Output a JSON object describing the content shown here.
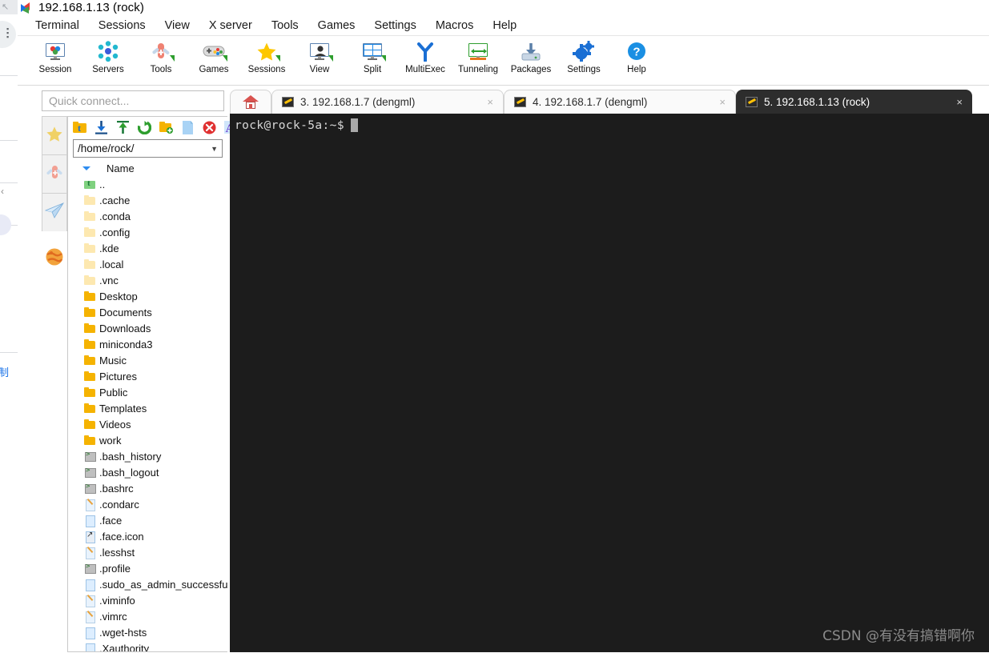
{
  "window": {
    "title": "192.168.1.13 (rock)",
    "logo_icon": "mobaxterm-logo-icon"
  },
  "menubar": {
    "items": [
      {
        "label": "Terminal"
      },
      {
        "label": "Sessions"
      },
      {
        "label": "View"
      },
      {
        "label": "X server"
      },
      {
        "label": "Tools"
      },
      {
        "label": "Games"
      },
      {
        "label": "Settings"
      },
      {
        "label": "Macros"
      },
      {
        "label": "Help"
      }
    ]
  },
  "toolbar": {
    "buttons": [
      {
        "label": "Session",
        "icon": "session-monitor-icon"
      },
      {
        "label": "Servers",
        "icon": "servers-nodes-icon"
      },
      {
        "label": "Tools",
        "icon": "swiss-knife-icon"
      },
      {
        "label": "Games",
        "icon": "gamepad-icon"
      },
      {
        "label": "Sessions",
        "icon": "star-icon"
      },
      {
        "label": "View",
        "icon": "view-monitor-icon"
      },
      {
        "label": "Split",
        "icon": "split-grid-icon"
      },
      {
        "label": "MultiExec",
        "icon": "multiexec-fork-icon"
      },
      {
        "label": "Tunneling",
        "icon": "tunneling-monitor-icon"
      },
      {
        "label": "Packages",
        "icon": "packages-download-icon"
      },
      {
        "label": "Settings",
        "icon": "gear-icon"
      },
      {
        "label": "Help",
        "icon": "help-question-icon"
      }
    ]
  },
  "sidebar": {
    "quick_connect": {
      "placeholder": "Quick connect..."
    },
    "vertical_tabs": [
      {
        "name": "sessions-star",
        "icon": "star-icon"
      },
      {
        "name": "tools",
        "icon": "swiss-knife-icon"
      },
      {
        "name": "sftp",
        "icon": "paper-plane-icon"
      },
      {
        "name": "macros",
        "icon": "globe-icon"
      }
    ],
    "sftp": {
      "tools": [
        {
          "name": "parent-folder",
          "icon": "folder-up-icon"
        },
        {
          "name": "download",
          "icon": "download-icon"
        },
        {
          "name": "upload",
          "icon": "upload-icon"
        },
        {
          "name": "refresh",
          "icon": "refresh-icon"
        },
        {
          "name": "new-folder",
          "icon": "new-folder-icon"
        },
        {
          "name": "new-file",
          "icon": "new-file-icon"
        },
        {
          "name": "delete",
          "icon": "delete-icon"
        },
        {
          "name": "text-mode",
          "icon": "text-a-icon"
        }
      ],
      "path": "/home/rock/",
      "path_chevron": "⌄",
      "column_header": "Name",
      "files": [
        {
          "name": "..",
          "type": "up"
        },
        {
          "name": ".cache",
          "type": "folder-light"
        },
        {
          "name": ".conda",
          "type": "folder-light"
        },
        {
          "name": ".config",
          "type": "folder-light"
        },
        {
          "name": ".kde",
          "type": "folder-light"
        },
        {
          "name": ".local",
          "type": "folder-light"
        },
        {
          "name": ".vnc",
          "type": "folder-light"
        },
        {
          "name": "Desktop",
          "type": "folder"
        },
        {
          "name": "Documents",
          "type": "folder"
        },
        {
          "name": "Downloads",
          "type": "folder"
        },
        {
          "name": "miniconda3",
          "type": "folder"
        },
        {
          "name": "Music",
          "type": "folder"
        },
        {
          "name": "Pictures",
          "type": "folder"
        },
        {
          "name": "Public",
          "type": "folder"
        },
        {
          "name": "Templates",
          "type": "folder"
        },
        {
          "name": "Videos",
          "type": "folder"
        },
        {
          "name": "work",
          "type": "folder"
        },
        {
          "name": ".bash_history",
          "type": "term"
        },
        {
          "name": ".bash_logout",
          "type": "term"
        },
        {
          "name": ".bashrc",
          "type": "term"
        },
        {
          "name": ".condarc",
          "type": "doc-pen"
        },
        {
          "name": ".face",
          "type": "doc"
        },
        {
          "name": ".face.icon",
          "type": "link"
        },
        {
          "name": ".lesshst",
          "type": "doc-pen"
        },
        {
          "name": ".profile",
          "type": "term"
        },
        {
          "name": ".sudo_as_admin_successful",
          "type": "doc"
        },
        {
          "name": ".viminfo",
          "type": "doc-pen"
        },
        {
          "name": ".vimrc",
          "type": "doc-pen"
        },
        {
          "name": ".wget-hsts",
          "type": "doc"
        },
        {
          "name": ".Xauthority",
          "type": "doc"
        }
      ]
    }
  },
  "tabs": {
    "home": {
      "name": "home-tab",
      "icon": "home-icon"
    },
    "items": [
      {
        "label": "3. 192.168.1.7 (dengml)",
        "icon": "key-icon",
        "active": false,
        "close": "×"
      },
      {
        "label": "4. 192.168.1.7 (dengml)",
        "icon": "key-icon",
        "active": false,
        "close": "×"
      },
      {
        "label": "5. 192.168.1.13 (rock)",
        "icon": "key-icon",
        "active": true,
        "close": "×"
      }
    ]
  },
  "terminal": {
    "prompt": "rock@rock-5a:~$",
    "cursor": "block",
    "watermark": "CSDN @有没有搞错啊你",
    "background_color": "#1c1c1c",
    "text_color": "#d8d8d8"
  },
  "background_window": {
    "cjk_fragment": "制",
    "dots": "⋮",
    "chevron": "↖"
  },
  "colors": {
    "accent_blue": "#2d8cf0",
    "folder_yellow": "#f5b301",
    "terminal_bg": "#1c1c1c",
    "tab_active_bg": "#2d2d2d"
  }
}
